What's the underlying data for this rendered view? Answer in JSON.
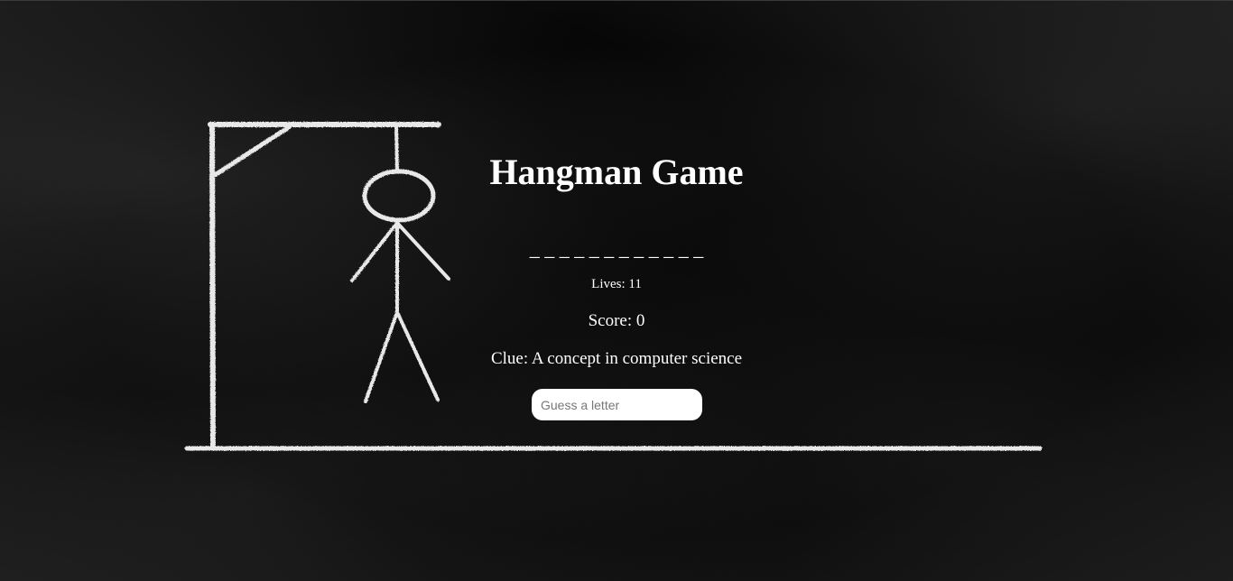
{
  "game": {
    "title": "Hangman Game",
    "word_mask": "_ _ _ _ _ _ _ _ _ _ _ _",
    "lives_text": "Lives: 11",
    "score_text": "Score: 0",
    "clue_text": "Clue: A concept in computer science",
    "guess_placeholder": "Guess a letter"
  },
  "colors": {
    "background": "#0b0b0b",
    "chalk": "#e8e8e8",
    "text": "#ffffff",
    "input_bg": "#ffffff"
  },
  "icons": {
    "gallows": "gallows-drawing",
    "stickman": "hanged-stickman-drawing"
  }
}
